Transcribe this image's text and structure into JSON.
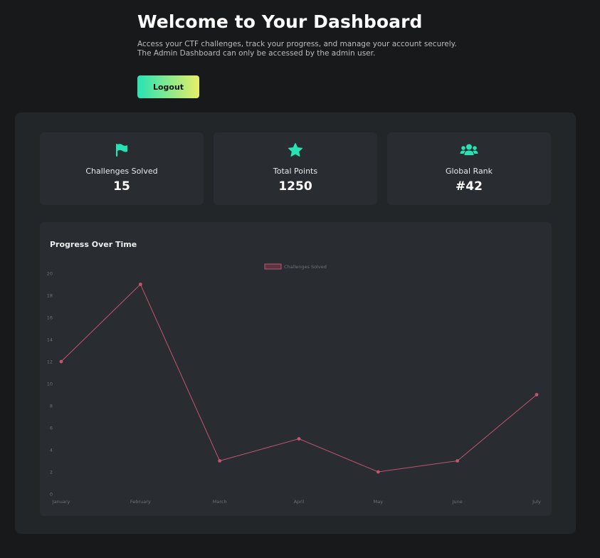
{
  "header": {
    "title": "Welcome to Your Dashboard",
    "subtitle_line1": "Access your CTF challenges, track your progress, and manage your account securely.",
    "subtitle_line2": "The Admin Dashboard can only be accessed by the admin user.",
    "logout_label": "Logout"
  },
  "stats": [
    {
      "label": "Challenges Solved",
      "value": "15",
      "icon": "flag-icon"
    },
    {
      "label": "Total Points",
      "value": "1250",
      "icon": "star-icon"
    },
    {
      "label": "Global Rank",
      "value": "#42",
      "icon": "users-icon"
    }
  ],
  "colors": {
    "accent": "#26e3b4",
    "accent_end": "#e8ef66",
    "series": "#c0566e"
  },
  "chart_title": "Progress Over Time",
  "chart_data": {
    "type": "line",
    "categories": [
      "January",
      "February",
      "March",
      "April",
      "May",
      "June",
      "July"
    ],
    "series": [
      {
        "name": "Challenges Solved",
        "values": [
          12,
          19,
          3,
          5,
          2,
          3,
          9
        ]
      }
    ],
    "yticks": [
      0,
      2,
      4,
      6,
      8,
      10,
      12,
      14,
      16,
      18,
      20
    ],
    "ylim": [
      0,
      20
    ],
    "legend": "top-center",
    "grid": false
  }
}
